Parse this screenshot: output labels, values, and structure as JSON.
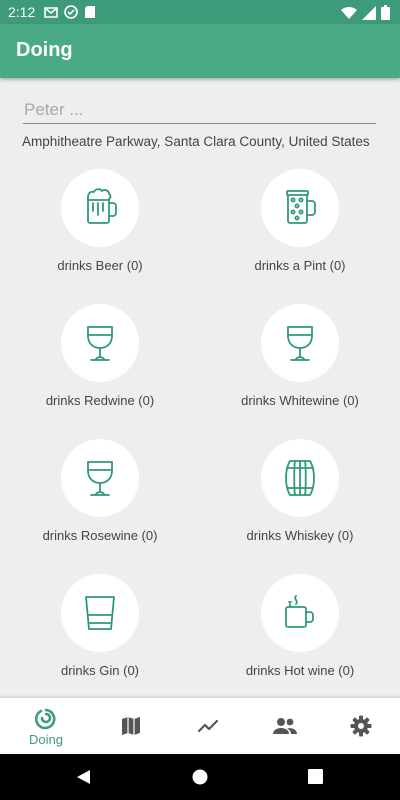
{
  "status_bar": {
    "time": "2:12",
    "left_icons": [
      "gmail-icon",
      "at-icon",
      "sd-card-icon"
    ],
    "right_icons": [
      "wifi-icon",
      "signal-icon",
      "battery-icon"
    ]
  },
  "app_bar": {
    "title": "Doing"
  },
  "name_field": {
    "value": "",
    "placeholder": "Peter ..."
  },
  "location": "Amphitheatre Parkway, Santa Clara County, United States",
  "drinks": [
    {
      "label": "drinks Beer (0)",
      "icon": "beer-mug-icon"
    },
    {
      "label": "drinks a Pint (0)",
      "icon": "pint-icon"
    },
    {
      "label": "drinks Redwine (0)",
      "icon": "wine-glass-icon"
    },
    {
      "label": "drinks Whitewine (0)",
      "icon": "wine-glass-icon"
    },
    {
      "label": "drinks Rosewine (0)",
      "icon": "wine-glass-icon"
    },
    {
      "label": "drinks Whiskey (0)",
      "icon": "barrel-icon"
    },
    {
      "label": "drinks Gin (0)",
      "icon": "tumbler-icon"
    },
    {
      "label": "drinks Hot wine (0)",
      "icon": "hot-mug-icon"
    }
  ],
  "bottom_nav": {
    "active_label": "Doing",
    "items": [
      "doing-icon",
      "map-icon",
      "chart-icon",
      "people-icon",
      "settings-icon"
    ]
  },
  "system_nav": [
    "back-icon",
    "home-icon",
    "recents-icon"
  ],
  "colors": {
    "primary": "#4aaa86",
    "primary_dark": "#3d9b7a",
    "icon": "#2f9a72",
    "background": "#eeeeee"
  }
}
